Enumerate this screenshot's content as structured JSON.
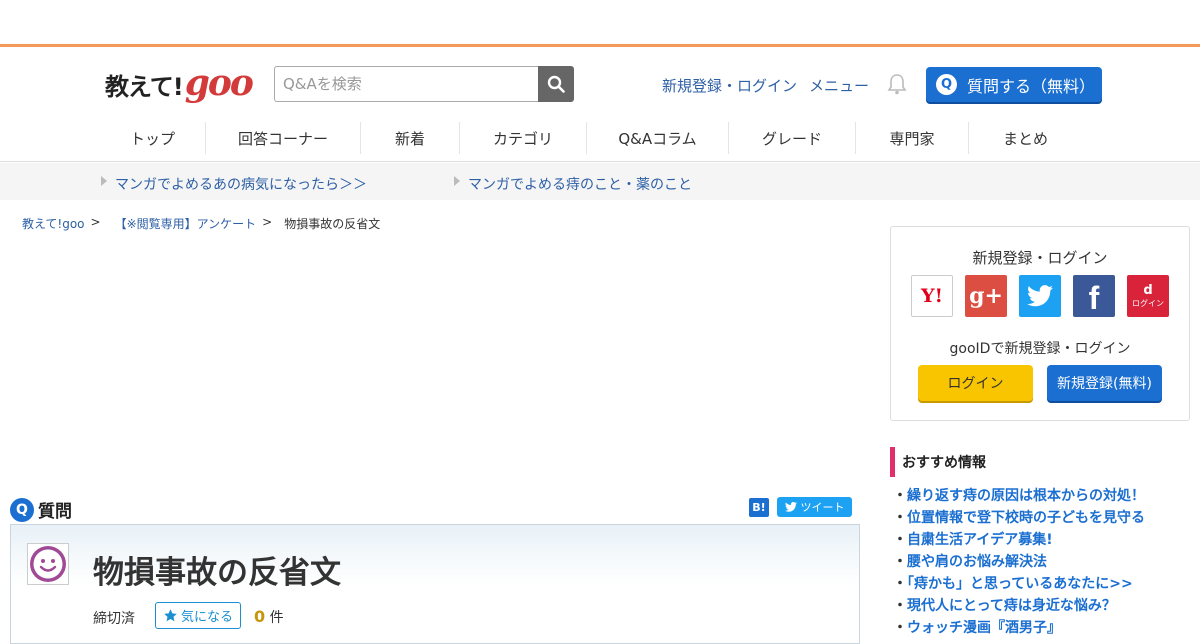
{
  "logo": {
    "text1": "教えて!",
    "text2": "goo"
  },
  "search": {
    "placeholder": "Q&Aを検索"
  },
  "header": {
    "login_link": "新規登録・ログイン",
    "menu_link": "メニュー",
    "ask_label": "質問する（無料）",
    "ask_icon_letter": "Q"
  },
  "nav": [
    "トップ",
    "回答コーナー",
    "新着",
    "カテゴリ",
    "Q&Aコラム",
    "グレード",
    "専門家",
    "まとめ"
  ],
  "subbar": [
    "マンガでよめるあの病気になったら＞＞",
    "マンガでよめる痔のこと・薬のこと"
  ],
  "breadcrumb": {
    "items": [
      "教えて!goo",
      "【※閲覧専用】アンケート"
    ],
    "sep": ">",
    "current": "物損事故の反省文"
  },
  "question": {
    "header_letter": "Q",
    "header_label": "質問",
    "hatena_label": "B!",
    "tweet_label": "ツイート",
    "title": "物損事故の反省文",
    "status": "締切済",
    "watch_label": "気になる",
    "watch_count": "0",
    "watch_unit": "件"
  },
  "sidebar": {
    "login_title": "新規登録・ログイン",
    "sns": [
      {
        "name": "yahoo",
        "label": "Y!",
        "color": "#ffffff"
      },
      {
        "name": "google-plus",
        "label": "g+",
        "color": "#dc4e41"
      },
      {
        "name": "twitter",
        "label": "",
        "color": "#1da1f2"
      },
      {
        "name": "facebook",
        "label": "f",
        "color": "#3b5998"
      },
      {
        "name": "docomo",
        "label": "ログイン",
        "color": "#d9233a"
      }
    ],
    "gooid_text": "gooIDで新規登録・ログイン",
    "login_button": "ログイン",
    "register_button": "新規登録(無料)",
    "recommend_title": "おすすめ情報",
    "recommend": [
      "繰り返す痔の原因は根本からの対処！",
      "位置情報で登下校時の子どもを見守る",
      "自粛生活アイデア募集!",
      "腰や肩のお悩み解決法",
      "「痔かも」と思っているあなたに>>",
      "現代人にとって痔は身近な悩み？",
      "ウォッチ漫画『酒男子』"
    ]
  }
}
